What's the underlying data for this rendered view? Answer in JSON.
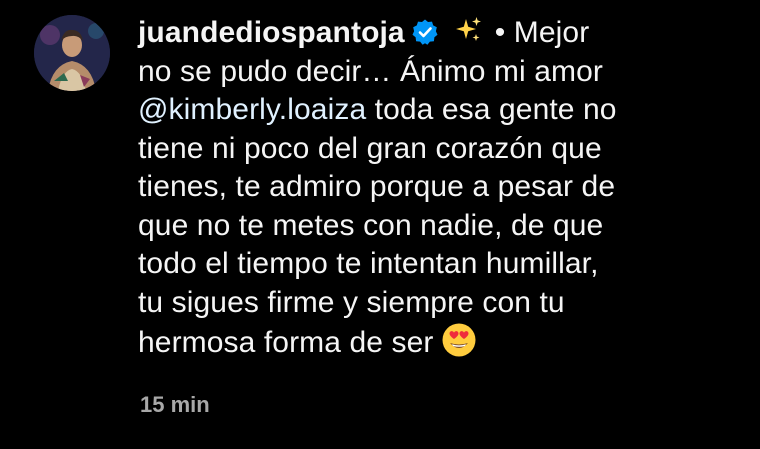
{
  "comment": {
    "username": "juandediospantoja",
    "verified": true,
    "sparkles_icon": "sparkles-emoji",
    "lines": [
      "• Mejor",
      "no se pudo decir… Ánimo mi amor",
      "@kimberly.loaiza",
      " toda esa gente no",
      "tiene ni poco del gran corazón que",
      "tienes, te admiro porque a pesar de",
      "que no te metes con nadie, de que",
      "todo el tiempo te intentan humillar,",
      "tu sigues firme y siempre con tu",
      "hermosa forma de ser"
    ],
    "end_emoji": "heart-eyes-emoji",
    "timestamp": "15 min"
  },
  "colors": {
    "background": "#000000",
    "text": "#f5f5f5",
    "mention": "#e0f1ff",
    "timestamp": "#a8a8a8",
    "verified_badge": "#0095f6"
  }
}
